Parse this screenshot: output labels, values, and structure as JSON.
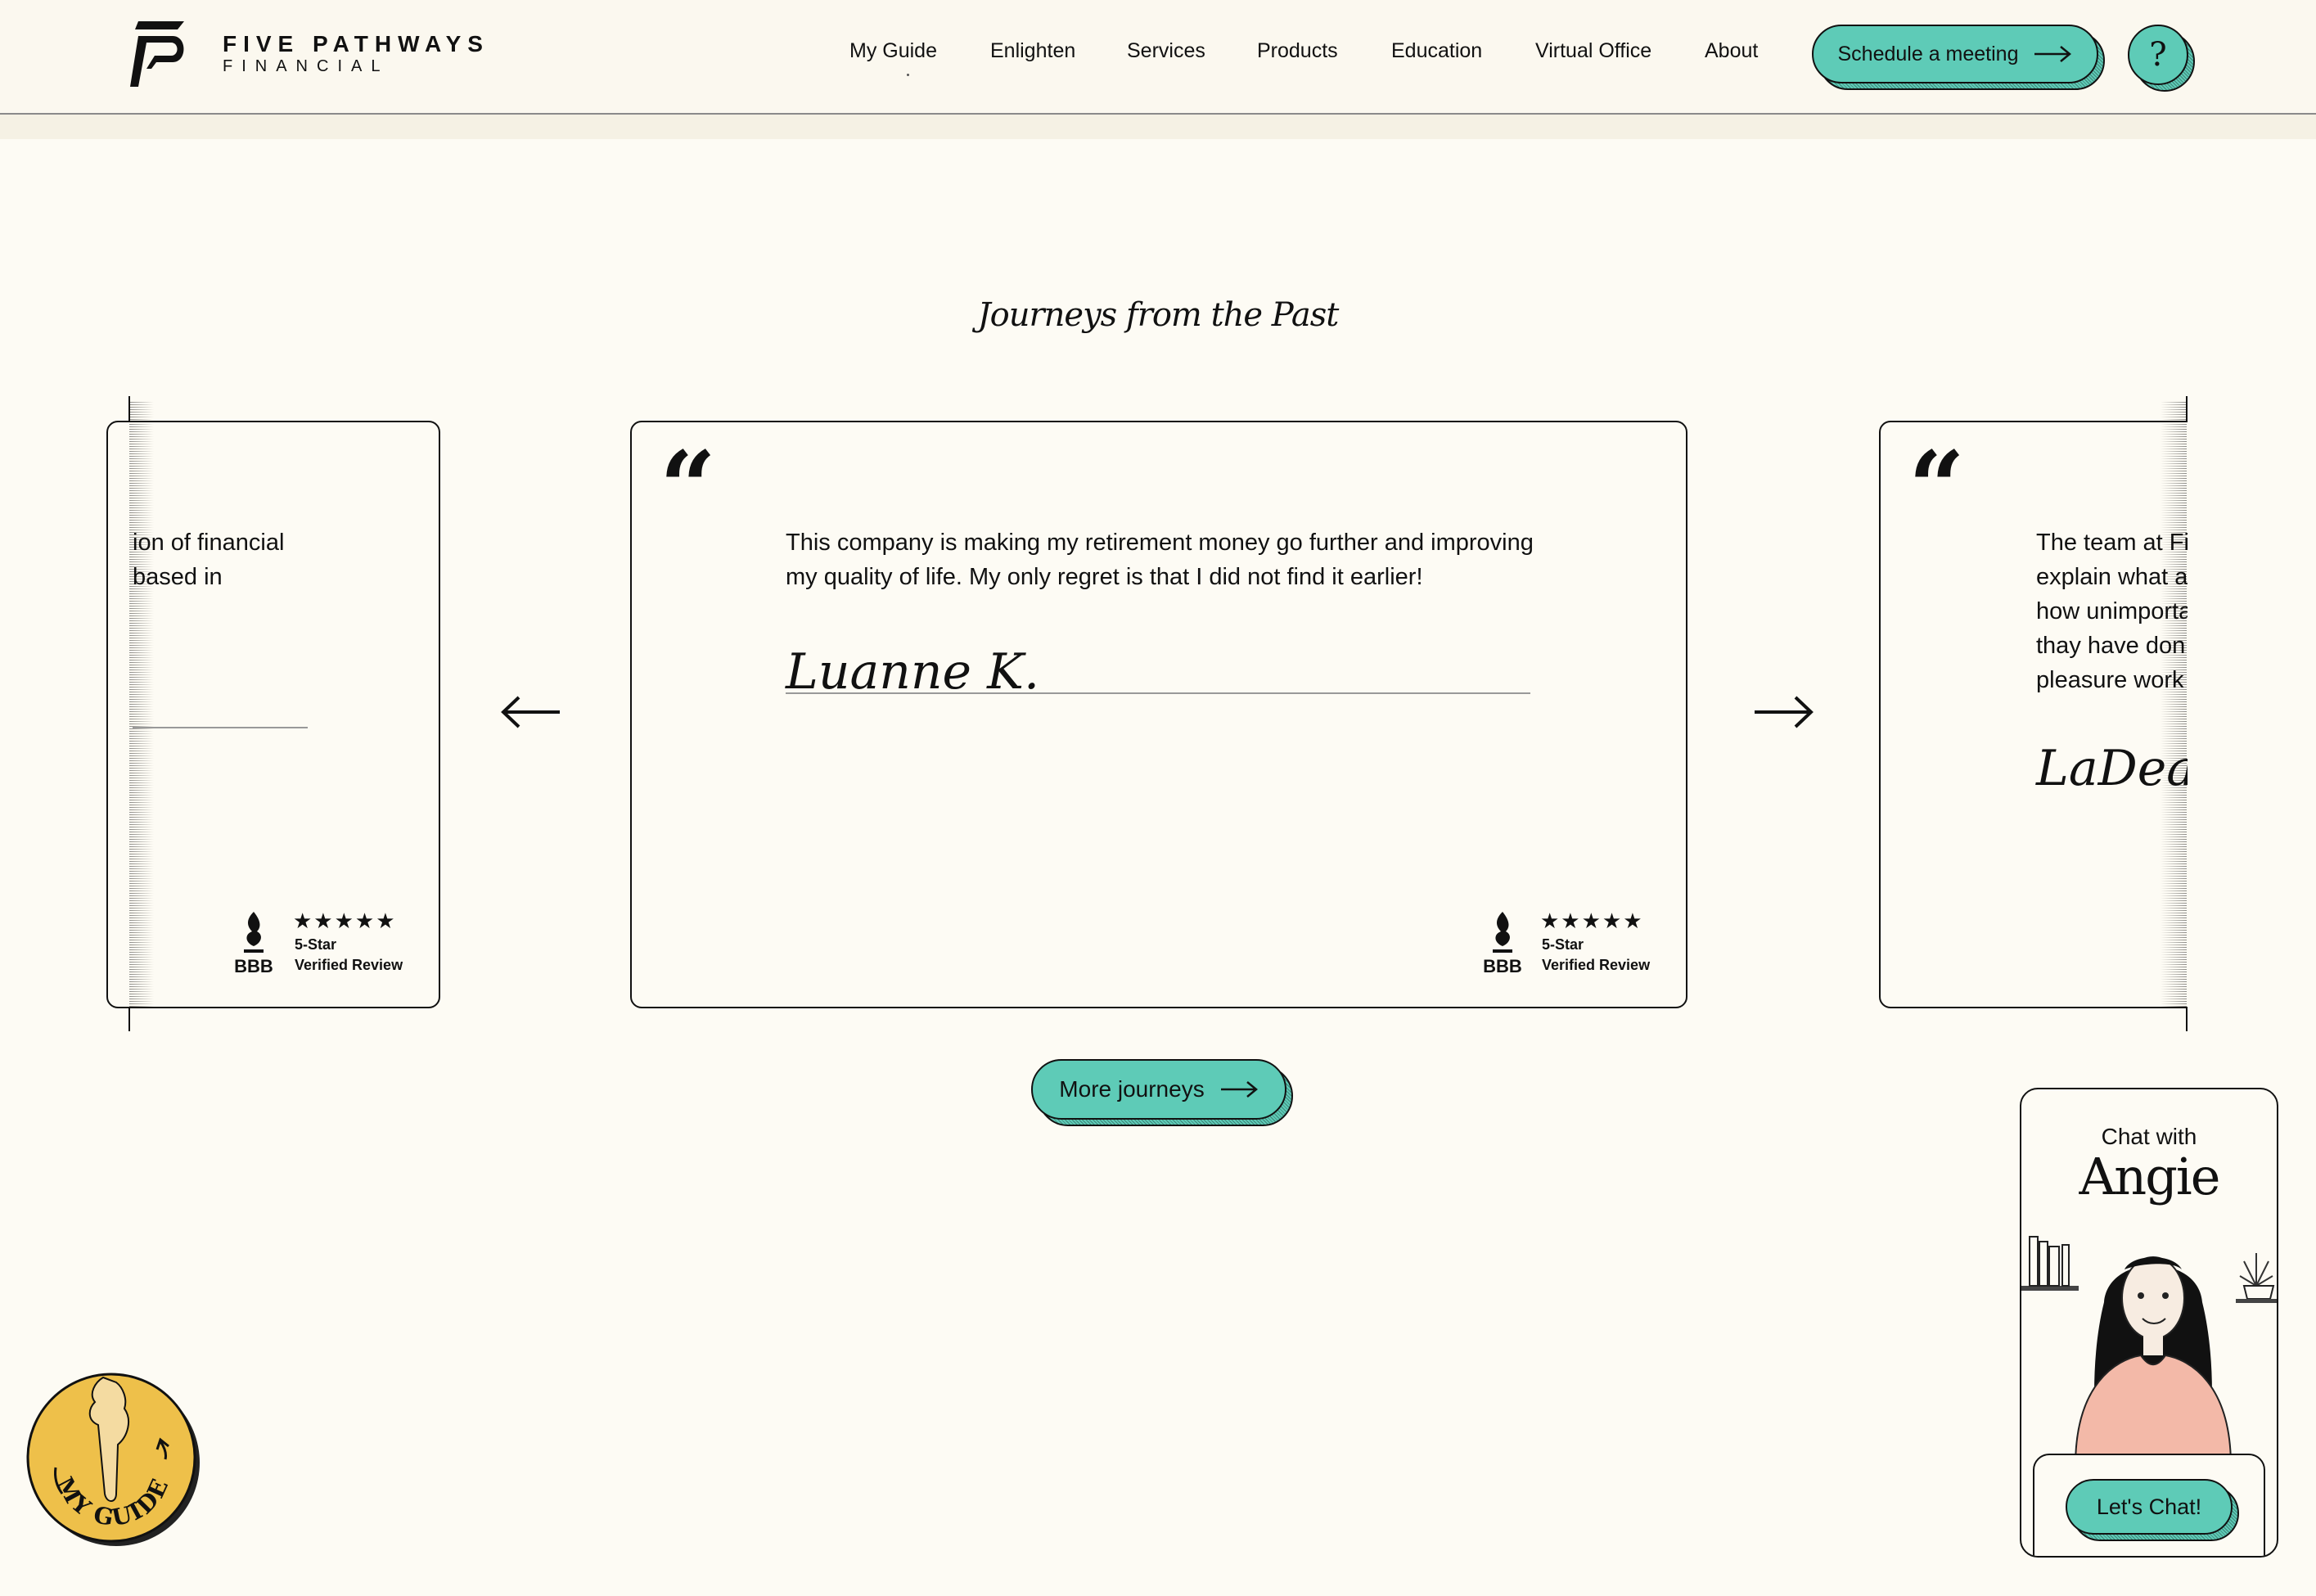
{
  "brand": {
    "name_line1": "FIVE PATHWAYS",
    "name_line2": "FINANCIAL"
  },
  "nav": {
    "items": [
      {
        "label": "My Guide"
      },
      {
        "label": "Enlighten"
      },
      {
        "label": "Services"
      },
      {
        "label": "Products"
      },
      {
        "label": "Education"
      },
      {
        "label": "Virtual Office"
      },
      {
        "label": "About"
      }
    ],
    "cta_label": "Schedule a meeting",
    "help_label": "?"
  },
  "testimonials": {
    "title": "Journeys from the Past",
    "prev_icon": "arrow-left-icon",
    "next_icon": "arrow-right-icon",
    "left_card": {
      "lines": [
        "ion of financial",
        "based in"
      ]
    },
    "center_card": {
      "quote_mark": "“",
      "quote": "This company is making my retirement money go further and improving my quality of life. My only regret is that I did not find it earlier!",
      "author": "Luanne K."
    },
    "right_card": {
      "quote_mark": "“",
      "lines": [
        "The team at Fi",
        "explain what a",
        "how unimporta",
        "thay have don",
        "pleasure work"
      ],
      "author": "LaDea"
    },
    "badge": {
      "logo": "BBB",
      "stars": "★★★★★",
      "line1": "5-Star",
      "line2": "Verified Review"
    },
    "more_label": "More journeys"
  },
  "chat": {
    "prefix": "Chat with",
    "name": "Angie",
    "button_label": "Let's Chat!"
  },
  "guide_coin": {
    "label": "MY GUIDE"
  },
  "colors": {
    "accent": "#5ecbb7",
    "background": "#fdfbf4",
    "header_bg": "#fbf8ef",
    "coin": "#eec04a"
  }
}
